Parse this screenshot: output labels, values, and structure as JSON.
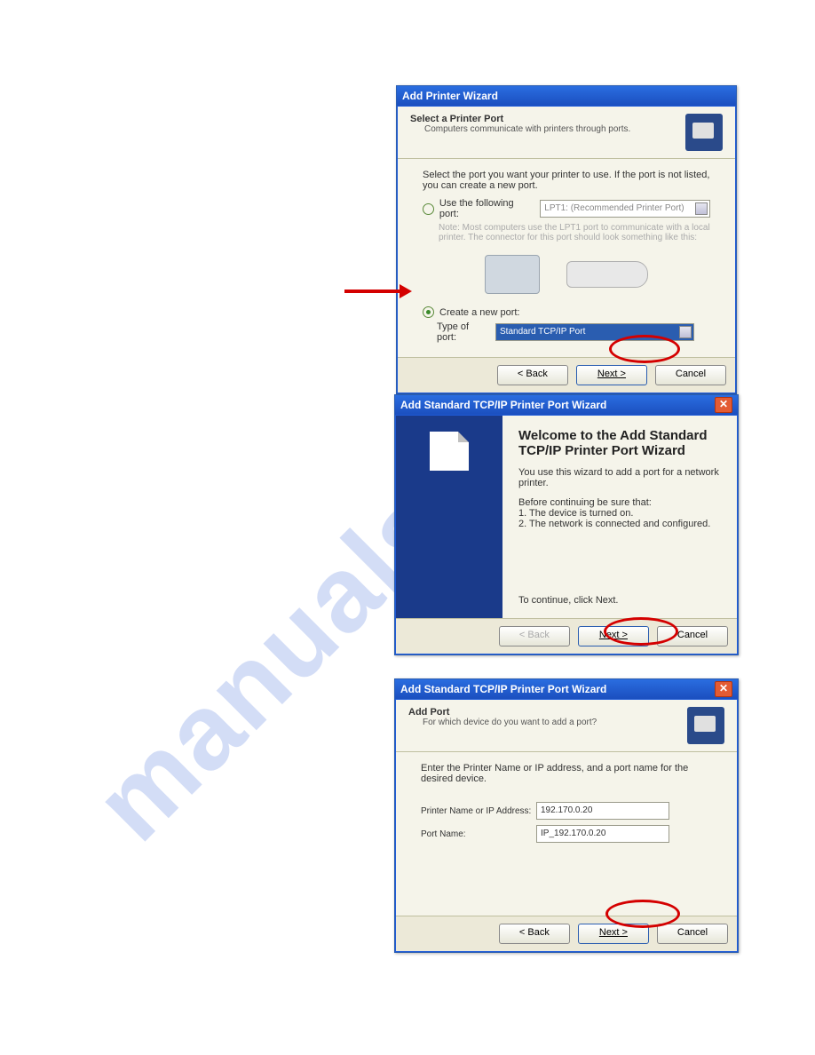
{
  "watermark": "manualslib.com",
  "dialog1": {
    "title": "Add Printer Wizard",
    "head_title": "Select a Printer Port",
    "head_sub": "Computers communicate with printers through ports.",
    "instruction": "Select the port you want your printer to use. If the port is not listed, you can create a new port.",
    "radio_use": "Use the following port:",
    "lpt_text": "LPT1: (Recommended Printer Port)",
    "note1": "Note: Most computers use the LPT1 port to communicate with a local printer. The connector for this port should look something like this:",
    "radio_create": "Create a new port:",
    "type_label": "Type of port:",
    "type_value": "Standard TCP/IP Port",
    "back": "< Back",
    "next": "Next >",
    "cancel": "Cancel"
  },
  "dialog2": {
    "title": "Add Standard TCP/IP Printer Port Wizard",
    "welcome_h": "Welcome to the Add Standard TCP/IP Printer Port Wizard",
    "desc": "You use this wizard to add a port for a network printer.",
    "before": "Before continuing be sure that:",
    "li1": "1. The device is turned on.",
    "li2": "2. The network is connected and configured.",
    "cont": "To continue, click Next.",
    "back": "< Back",
    "next": "Next >",
    "cancel": "Cancel"
  },
  "dialog3": {
    "title": "Add Standard TCP/IP Printer Port Wizard",
    "head_title": "Add Port",
    "head_sub": "For which device do you want to add a port?",
    "instruction": "Enter the Printer Name or IP address, and a port name for the desired device.",
    "ip_label": "Printer Name or IP Address:",
    "ip_value": "192.170.0.20",
    "port_label": "Port Name:",
    "port_value": "IP_192.170.0.20",
    "back": "< Back",
    "next": "Next >",
    "cancel": "Cancel"
  }
}
